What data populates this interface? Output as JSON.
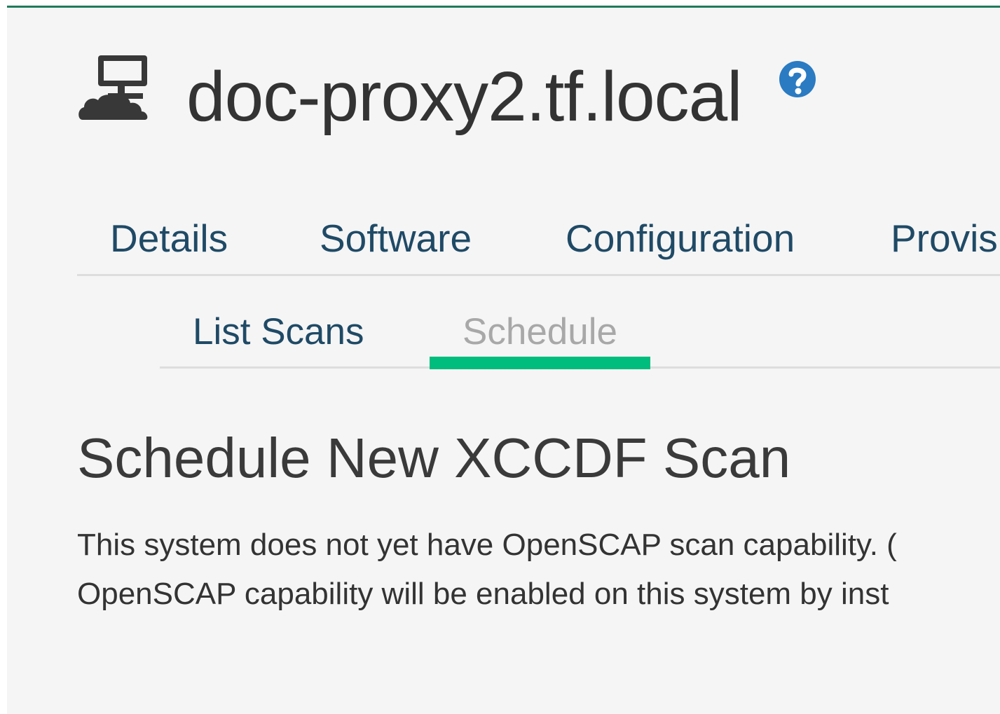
{
  "header": {
    "icon": "system-proxy-icon",
    "title": "doc-proxy2.tf.local",
    "help_icon": "question-circle-icon",
    "help_color": "#2a7bc2"
  },
  "tabs": [
    {
      "label": "Details"
    },
    {
      "label": "Software"
    },
    {
      "label": "Configuration"
    },
    {
      "label": "Provisi"
    }
  ],
  "subtabs": [
    {
      "label": "List Scans",
      "active": false
    },
    {
      "label": "Schedule",
      "active": true
    }
  ],
  "section": {
    "title": "Schedule New XCCDF Scan",
    "message_line1": "This system does not yet have OpenSCAP scan capability. (",
    "message_line2": "OpenSCAP capability will be enabled on this system by inst"
  },
  "colors": {
    "accent_border": "#1f7a5c",
    "active_underline": "#00bd7d",
    "link": "#1f4a66",
    "inactive_subtab": "#a8a8a8"
  }
}
